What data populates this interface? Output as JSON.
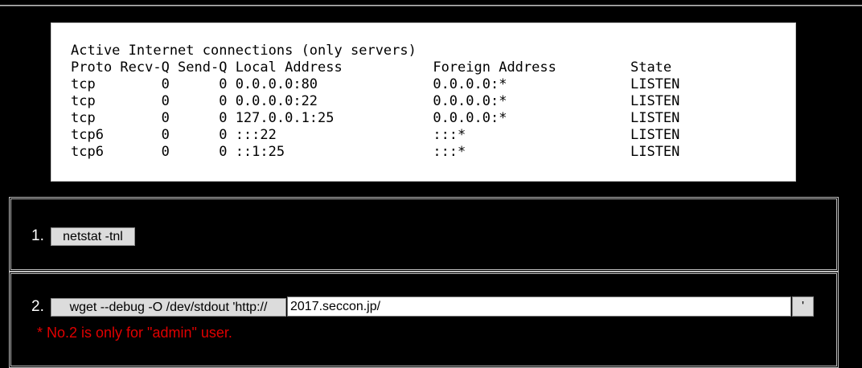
{
  "output": {
    "lines": [
      "Active Internet connections (only servers)",
      "Proto Recv-Q Send-Q Local Address           Foreign Address         State",
      "tcp        0      0 0.0.0.0:80              0.0.0.0:*               LISTEN",
      "tcp        0      0 0.0.0.0:22              0.0.0.0:*               LISTEN",
      "tcp        0      0 127.0.0.1:25            0.0.0.0:*               LISTEN",
      "tcp6       0      0 :::22                   :::*                    LISTEN",
      "tcp6       0      0 ::1:25                  :::*                    LISTEN"
    ]
  },
  "commands": {
    "item1": {
      "number": "1.",
      "button_label": "netstat -tnl"
    },
    "item2": {
      "number": "2.",
      "button_label": "wget --debug -O /dev/stdout 'http://",
      "url_value": "2017.seccon.jp/",
      "close_button_label": "'",
      "note": "* No.2 is only for \"admin\" user."
    }
  },
  "colors": {
    "background": "#000000",
    "output_background": "#ffffff",
    "note": "#e00000"
  }
}
